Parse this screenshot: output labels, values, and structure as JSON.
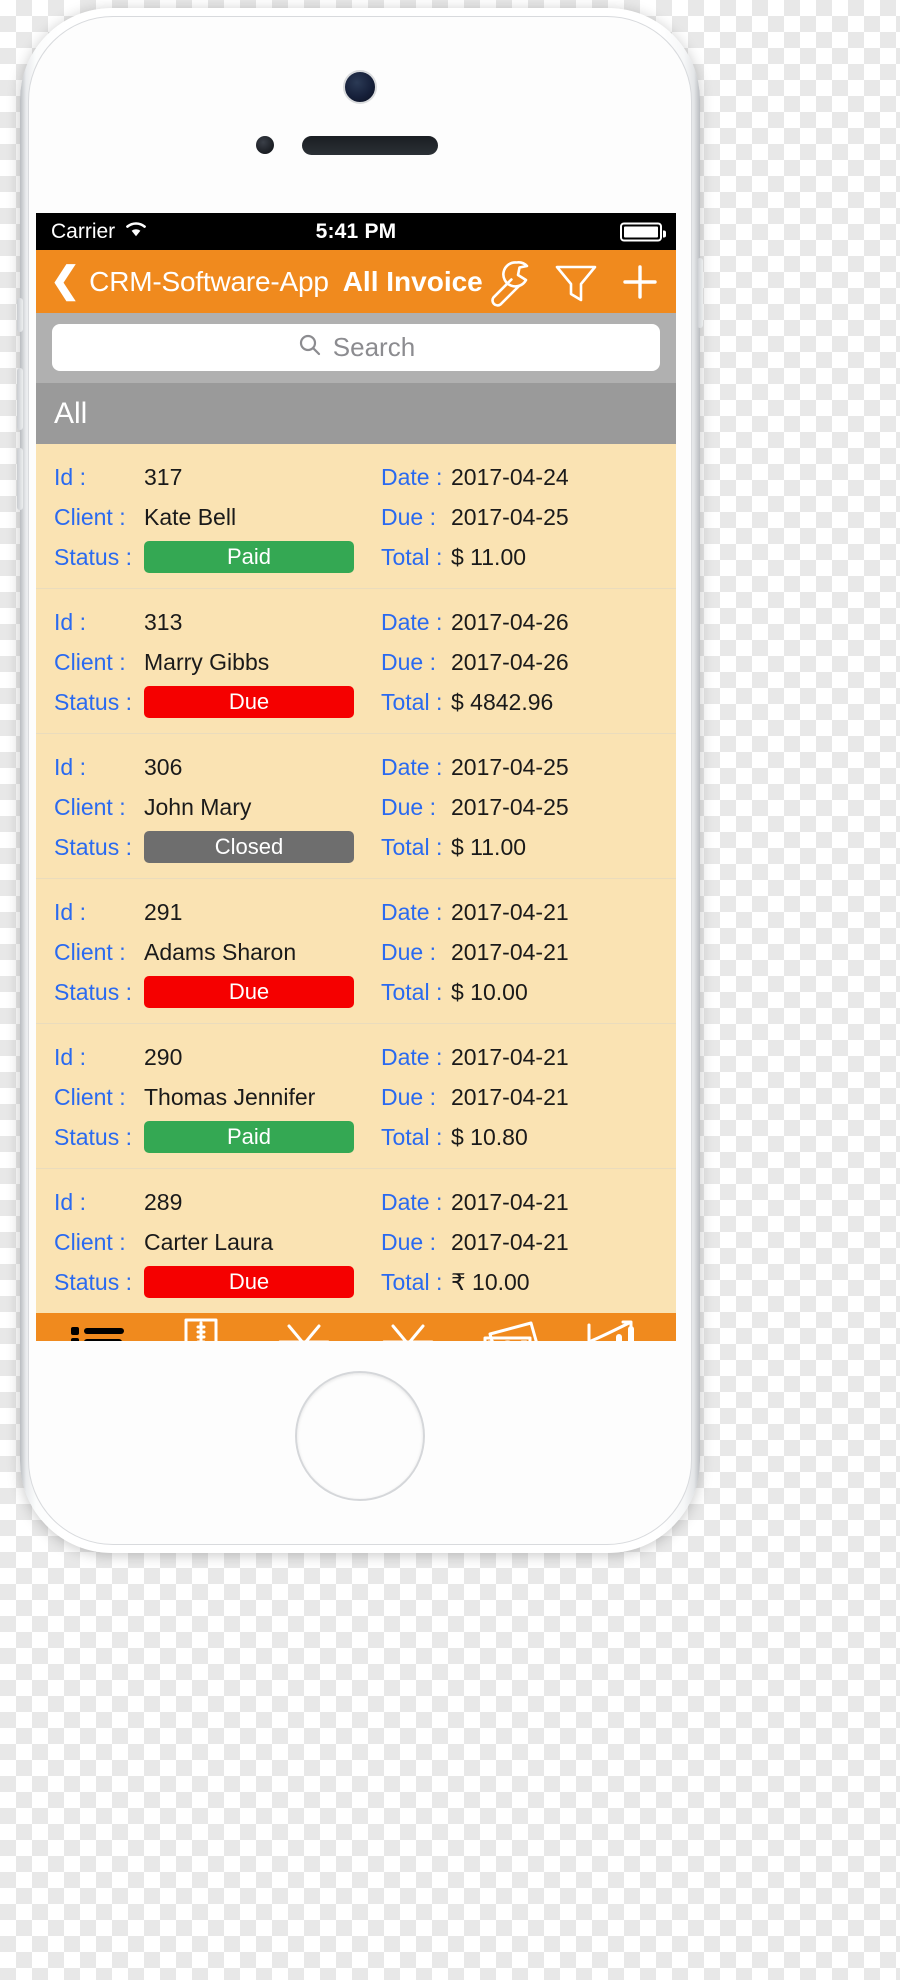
{
  "status_bar": {
    "carrier": "Carrier",
    "wifi_icon": "wifi-icon",
    "time": "5:41 PM",
    "battery_icon": "battery-full-icon"
  },
  "nav_bar": {
    "back_chevron_icon": "chevron-left-icon",
    "back_label": "CRM-Software-App",
    "title": "All Invoice",
    "actions": [
      {
        "name": "wrench-icon",
        "label": "Settings"
      },
      {
        "name": "filter-icon",
        "label": "Filter"
      },
      {
        "name": "plus-icon",
        "label": "Add Invoice"
      }
    ],
    "background_color": "#f08a1e"
  },
  "search": {
    "icon": "search-icon",
    "placeholder": "Search",
    "value": ""
  },
  "section": {
    "title": "All"
  },
  "list_labels": {
    "id": "Id :",
    "client": "Client :",
    "status": "Status :",
    "date": "Date :",
    "due": "Due :",
    "total": "Total :"
  },
  "status_colors": {
    "paid": "#34a853",
    "due": "#f50000",
    "closed": "#6e6e6e"
  },
  "invoices": [
    {
      "id": "317",
      "client": "Kate Bell",
      "status": "Paid",
      "status_type": "paid",
      "date": "2017-04-24",
      "due": "2017-04-25",
      "total": "$ 11.00"
    },
    {
      "id": "313",
      "client": "Marry Gibbs",
      "status": "Due",
      "status_type": "due",
      "date": "2017-04-26",
      "due": "2017-04-26",
      "total": "$ 4842.96"
    },
    {
      "id": "306",
      "client": "John Mary",
      "status": "Closed",
      "status_type": "closed",
      "date": "2017-04-25",
      "due": "2017-04-25",
      "total": "$ 11.00"
    },
    {
      "id": "291",
      "client": "Adams Sharon",
      "status": "Due",
      "status_type": "due",
      "date": "2017-04-21",
      "due": "2017-04-21",
      "total": "$ 10.00"
    },
    {
      "id": "290",
      "client": "Thomas Jennifer",
      "status": "Paid",
      "status_type": "paid",
      "date": "2017-04-21",
      "due": "2017-04-21",
      "total": "$ 10.80"
    },
    {
      "id": "289",
      "client": "Carter Laura",
      "status": "Due",
      "status_type": "due",
      "date": "2017-04-21",
      "due": "2017-04-21",
      "total": "₹ 10.00"
    }
  ],
  "tab_bar": {
    "background_color": "#f08a1e",
    "items": [
      {
        "icon": "list-icon",
        "label": "Invoices",
        "active": true
      },
      {
        "icon": "ruler-icon",
        "label": "Estimates",
        "active": false
      },
      {
        "icon": "basket-check-icon",
        "label": "Orders",
        "active": false
      },
      {
        "icon": "basket-icon",
        "label": "Cart",
        "active": false
      },
      {
        "icon": "money-icon",
        "label": "Payments",
        "active": false
      },
      {
        "icon": "bar-chart-icon",
        "label": "Reports",
        "active": false
      }
    ]
  }
}
